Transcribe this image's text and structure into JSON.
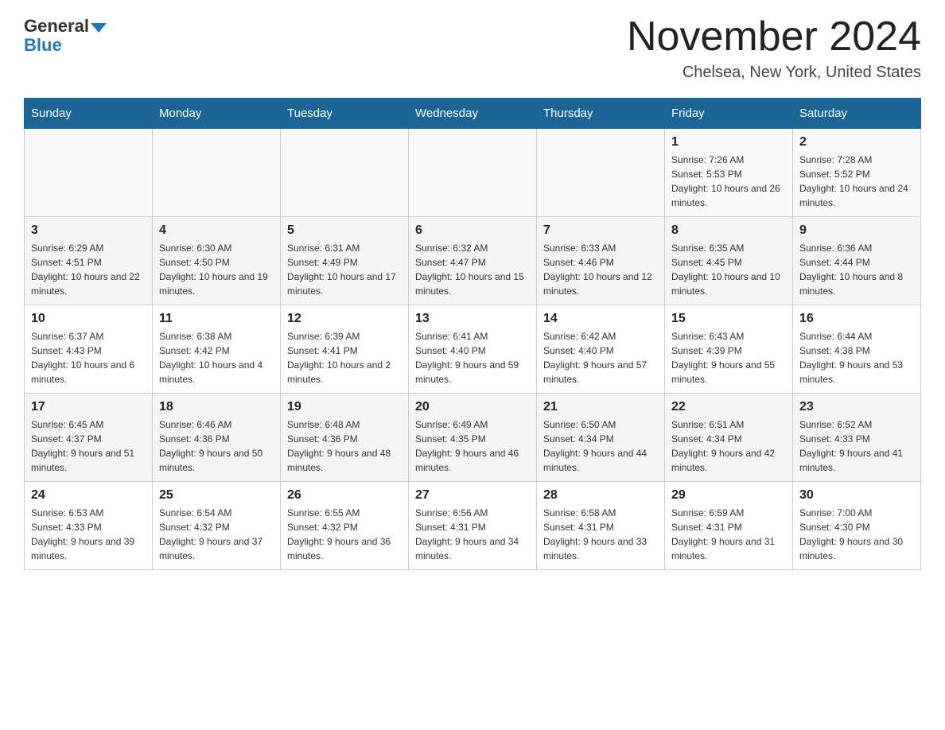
{
  "header": {
    "logo_general": "General",
    "logo_blue": "Blue",
    "month_title": "November 2024",
    "location": "Chelsea, New York, United States"
  },
  "days_of_week": [
    "Sunday",
    "Monday",
    "Tuesday",
    "Wednesday",
    "Thursday",
    "Friday",
    "Saturday"
  ],
  "weeks": [
    [
      {
        "day": "",
        "info": ""
      },
      {
        "day": "",
        "info": ""
      },
      {
        "day": "",
        "info": ""
      },
      {
        "day": "",
        "info": ""
      },
      {
        "day": "",
        "info": ""
      },
      {
        "day": "1",
        "info": "Sunrise: 7:26 AM\nSunset: 5:53 PM\nDaylight: 10 hours and 26 minutes."
      },
      {
        "day": "2",
        "info": "Sunrise: 7:28 AM\nSunset: 5:52 PM\nDaylight: 10 hours and 24 minutes."
      }
    ],
    [
      {
        "day": "3",
        "info": "Sunrise: 6:29 AM\nSunset: 4:51 PM\nDaylight: 10 hours and 22 minutes."
      },
      {
        "day": "4",
        "info": "Sunrise: 6:30 AM\nSunset: 4:50 PM\nDaylight: 10 hours and 19 minutes."
      },
      {
        "day": "5",
        "info": "Sunrise: 6:31 AM\nSunset: 4:49 PM\nDaylight: 10 hours and 17 minutes."
      },
      {
        "day": "6",
        "info": "Sunrise: 6:32 AM\nSunset: 4:47 PM\nDaylight: 10 hours and 15 minutes."
      },
      {
        "day": "7",
        "info": "Sunrise: 6:33 AM\nSunset: 4:46 PM\nDaylight: 10 hours and 12 minutes."
      },
      {
        "day": "8",
        "info": "Sunrise: 6:35 AM\nSunset: 4:45 PM\nDaylight: 10 hours and 10 minutes."
      },
      {
        "day": "9",
        "info": "Sunrise: 6:36 AM\nSunset: 4:44 PM\nDaylight: 10 hours and 8 minutes."
      }
    ],
    [
      {
        "day": "10",
        "info": "Sunrise: 6:37 AM\nSunset: 4:43 PM\nDaylight: 10 hours and 6 minutes."
      },
      {
        "day": "11",
        "info": "Sunrise: 6:38 AM\nSunset: 4:42 PM\nDaylight: 10 hours and 4 minutes."
      },
      {
        "day": "12",
        "info": "Sunrise: 6:39 AM\nSunset: 4:41 PM\nDaylight: 10 hours and 2 minutes."
      },
      {
        "day": "13",
        "info": "Sunrise: 6:41 AM\nSunset: 4:40 PM\nDaylight: 9 hours and 59 minutes."
      },
      {
        "day": "14",
        "info": "Sunrise: 6:42 AM\nSunset: 4:40 PM\nDaylight: 9 hours and 57 minutes."
      },
      {
        "day": "15",
        "info": "Sunrise: 6:43 AM\nSunset: 4:39 PM\nDaylight: 9 hours and 55 minutes."
      },
      {
        "day": "16",
        "info": "Sunrise: 6:44 AM\nSunset: 4:38 PM\nDaylight: 9 hours and 53 minutes."
      }
    ],
    [
      {
        "day": "17",
        "info": "Sunrise: 6:45 AM\nSunset: 4:37 PM\nDaylight: 9 hours and 51 minutes."
      },
      {
        "day": "18",
        "info": "Sunrise: 6:46 AM\nSunset: 4:36 PM\nDaylight: 9 hours and 50 minutes."
      },
      {
        "day": "19",
        "info": "Sunrise: 6:48 AM\nSunset: 4:36 PM\nDaylight: 9 hours and 48 minutes."
      },
      {
        "day": "20",
        "info": "Sunrise: 6:49 AM\nSunset: 4:35 PM\nDaylight: 9 hours and 46 minutes."
      },
      {
        "day": "21",
        "info": "Sunrise: 6:50 AM\nSunset: 4:34 PM\nDaylight: 9 hours and 44 minutes."
      },
      {
        "day": "22",
        "info": "Sunrise: 6:51 AM\nSunset: 4:34 PM\nDaylight: 9 hours and 42 minutes."
      },
      {
        "day": "23",
        "info": "Sunrise: 6:52 AM\nSunset: 4:33 PM\nDaylight: 9 hours and 41 minutes."
      }
    ],
    [
      {
        "day": "24",
        "info": "Sunrise: 6:53 AM\nSunset: 4:33 PM\nDaylight: 9 hours and 39 minutes."
      },
      {
        "day": "25",
        "info": "Sunrise: 6:54 AM\nSunset: 4:32 PM\nDaylight: 9 hours and 37 minutes."
      },
      {
        "day": "26",
        "info": "Sunrise: 6:55 AM\nSunset: 4:32 PM\nDaylight: 9 hours and 36 minutes."
      },
      {
        "day": "27",
        "info": "Sunrise: 6:56 AM\nSunset: 4:31 PM\nDaylight: 9 hours and 34 minutes."
      },
      {
        "day": "28",
        "info": "Sunrise: 6:58 AM\nSunset: 4:31 PM\nDaylight: 9 hours and 33 minutes."
      },
      {
        "day": "29",
        "info": "Sunrise: 6:59 AM\nSunset: 4:31 PM\nDaylight: 9 hours and 31 minutes."
      },
      {
        "day": "30",
        "info": "Sunrise: 7:00 AM\nSunset: 4:30 PM\nDaylight: 9 hours and 30 minutes."
      }
    ]
  ]
}
